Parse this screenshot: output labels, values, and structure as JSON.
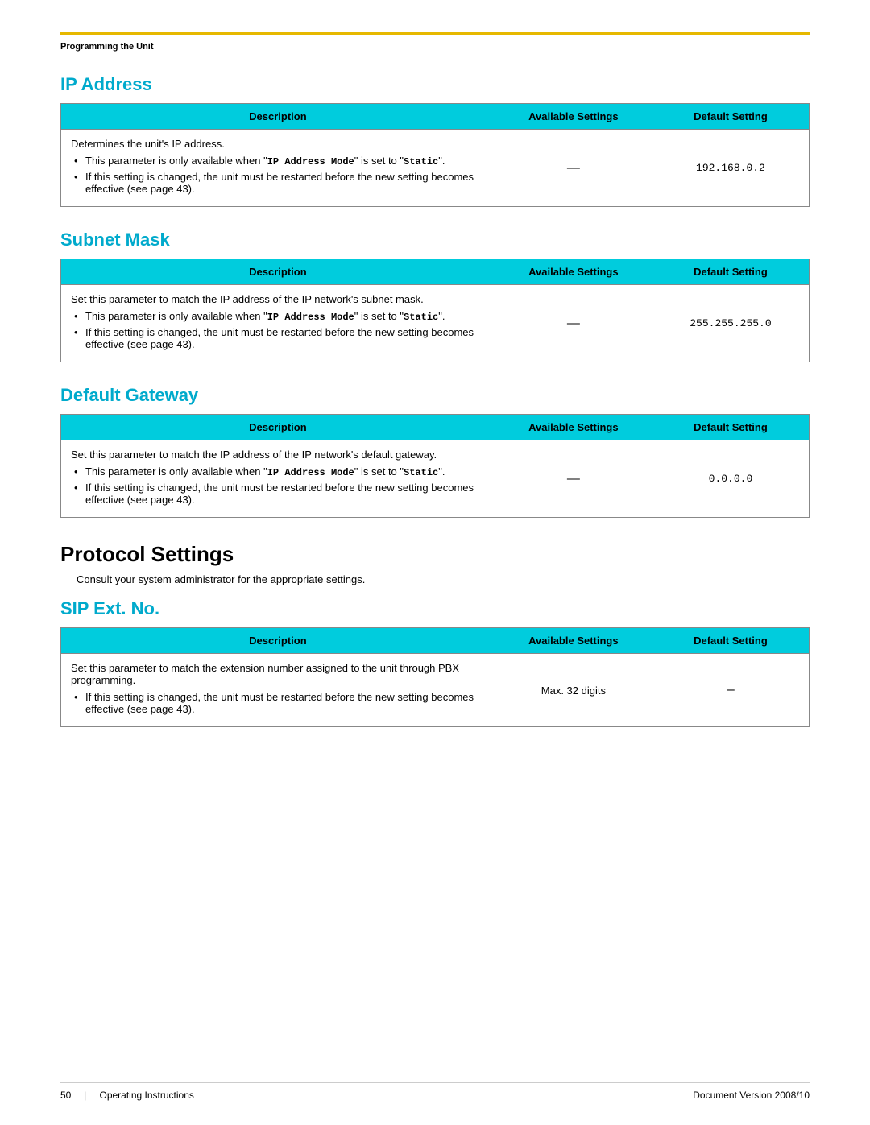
{
  "header": {
    "breadcrumb": "Programming the Unit",
    "accent_color": "#e6b800"
  },
  "sections": [
    {
      "id": "ip-address",
      "heading": "IP Address",
      "heading_type": "cyan",
      "table": {
        "col_description": "Description",
        "col_available": "Available Settings",
        "col_default": "Default Setting",
        "description_lines": [
          "Determines the unit's IP address."
        ],
        "bullets": [
          "This parameter is only available when \"IP Address Mode\" is set to \"Static\".",
          "If this setting is changed, the unit must be restarted before the new setting becomes effective (see page 43)."
        ],
        "available": "—",
        "default": "192.168.0.2"
      }
    },
    {
      "id": "subnet-mask",
      "heading": "Subnet Mask",
      "heading_type": "cyan",
      "table": {
        "col_description": "Description",
        "col_available": "Available Settings",
        "col_default": "Default Setting",
        "description_lines": [
          "Set this parameter to match the IP address of the IP network's subnet mask."
        ],
        "bullets": [
          "This parameter is only available when \"IP Address Mode\" is set to \"Static\".",
          "If this setting is changed, the unit must be restarted before the new setting becomes effective (see page 43)."
        ],
        "available": "—",
        "default": "255.255.255.0"
      }
    },
    {
      "id": "default-gateway",
      "heading": "Default Gateway",
      "heading_type": "cyan",
      "table": {
        "col_description": "Description",
        "col_available": "Available Settings",
        "col_default": "Default Setting",
        "description_lines": [
          "Set this parameter to match the IP address of the IP network's default gateway."
        ],
        "bullets": [
          "This parameter is only available when \"IP Address Mode\" is set to \"Static\".",
          "If this setting is changed, the unit must be restarted before the new setting becomes effective (see page 43)."
        ],
        "available": "—",
        "default": "0.0.0.0"
      }
    }
  ],
  "protocol_settings": {
    "heading": "Protocol Settings",
    "subtext": "Consult your system administrator for the appropriate settings."
  },
  "sip_section": {
    "heading": "SIP Ext. No.",
    "heading_type": "cyan",
    "table": {
      "col_description": "Description",
      "col_available": "Available Settings",
      "col_default": "Default Setting",
      "description_lines": [
        "Set this parameter to match the extension number assigned to the unit through PBX programming."
      ],
      "bullets": [
        "If this setting is changed, the unit must be restarted before the new setting becomes effective (see page 43)."
      ],
      "available": "Max. 32 digits",
      "default": "—"
    }
  },
  "footer": {
    "page_number": "50",
    "left_label": "Operating Instructions",
    "right_label": "Document Version   2008/10"
  }
}
